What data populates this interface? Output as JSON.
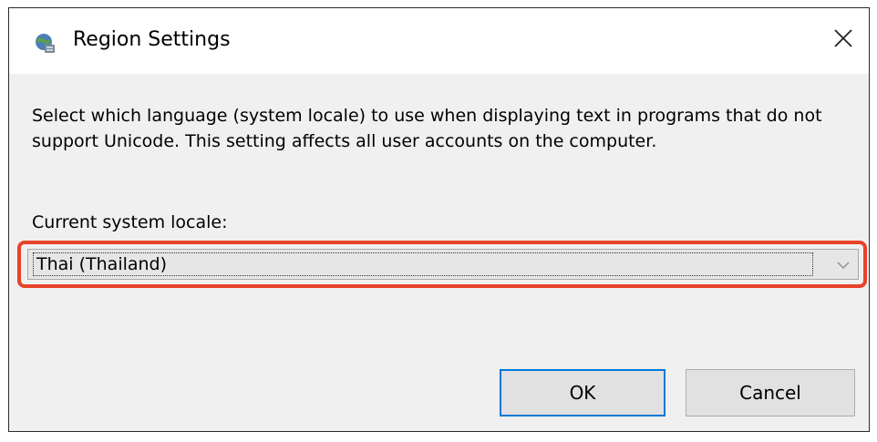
{
  "window": {
    "title": "Region Settings",
    "icon": "globe-settings-icon",
    "close_icon": "close-icon"
  },
  "content": {
    "description": "Select which language (system locale) to use when displaying text in programs that do not support Unicode. This setting affects all user accounts on the computer.",
    "locale_label": "Current system locale:",
    "locale_value": "Thai (Thailand)",
    "highlight_color": "#e8432a"
  },
  "buttons": {
    "ok_label": "OK",
    "cancel_label": "Cancel"
  }
}
